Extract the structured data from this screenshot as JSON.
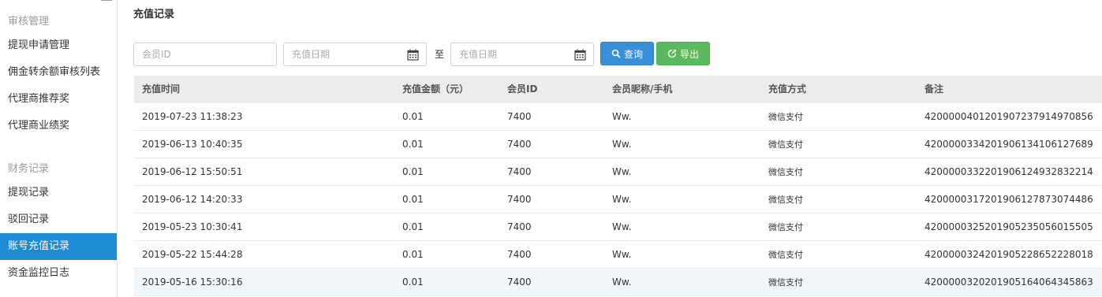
{
  "sidebar": {
    "section_audit": "审核管理",
    "audit_items": [
      {
        "label": "提现申请管理"
      },
      {
        "label": "佣金转余额审核列表"
      },
      {
        "label": "代理商推荐奖"
      },
      {
        "label": "代理商业绩奖"
      }
    ],
    "section_finance": "财务记录",
    "finance_items": [
      {
        "label": "提现记录"
      },
      {
        "label": "驳回记录"
      },
      {
        "label": "账号充值记录",
        "active": true
      },
      {
        "label": "资金监控日志"
      }
    ]
  },
  "page": {
    "title": "充值记录"
  },
  "filters": {
    "member_id_placeholder": "会员ID",
    "start_date_placeholder": "充值日期",
    "to_label": "至",
    "end_date_placeholder": "充值日期",
    "query_label": "查询",
    "export_label": "导出"
  },
  "table": {
    "columns": [
      "充值时间",
      "充值金额（元）",
      "会员ID",
      "会员昵称/手机",
      "充值方式",
      "备注"
    ],
    "rows": [
      {
        "time": "2019-07-23 11:38:23",
        "amount": "0.01",
        "member_id": "7400",
        "nickname": "Ww.",
        "method": "微信支付",
        "note": "4200000401201907237914970856"
      },
      {
        "time": "2019-06-13 10:40:35",
        "amount": "0.01",
        "member_id": "7400",
        "nickname": "Ww.",
        "method": "微信支付",
        "note": "4200000334201906134106127689"
      },
      {
        "time": "2019-06-12 15:50:51",
        "amount": "0.01",
        "member_id": "7400",
        "nickname": "Ww.",
        "method": "微信支付",
        "note": "4200000332201906124932832214"
      },
      {
        "time": "2019-06-12 14:20:33",
        "amount": "0.01",
        "member_id": "7400",
        "nickname": "Ww.",
        "method": "微信支付",
        "note": "4200000317201906127873074486"
      },
      {
        "time": "2019-05-23 10:30:41",
        "amount": "0.01",
        "member_id": "7400",
        "nickname": "Ww.",
        "method": "微信支付",
        "note": "4200000325201905235056015505"
      },
      {
        "time": "2019-05-22 15:44:28",
        "amount": "0.01",
        "member_id": "7400",
        "nickname": "Ww.",
        "method": "微信支付",
        "note": "4200000324201905228652228018"
      },
      {
        "time": "2019-05-16 15:30:16",
        "amount": "0.01",
        "member_id": "7400",
        "nickname": "Ww.",
        "method": "微信支付",
        "note": "4200000320201905164064345863"
      }
    ]
  },
  "colors": {
    "active_nav": "#1e8bd5",
    "query_button": "#3a8fd9",
    "export_button": "#5cb85c",
    "table_header": "#ececec"
  },
  "icons": {
    "menu": "hamburger-icon",
    "calendar": "calendar-icon",
    "search": "search-icon",
    "export": "export-icon"
  }
}
